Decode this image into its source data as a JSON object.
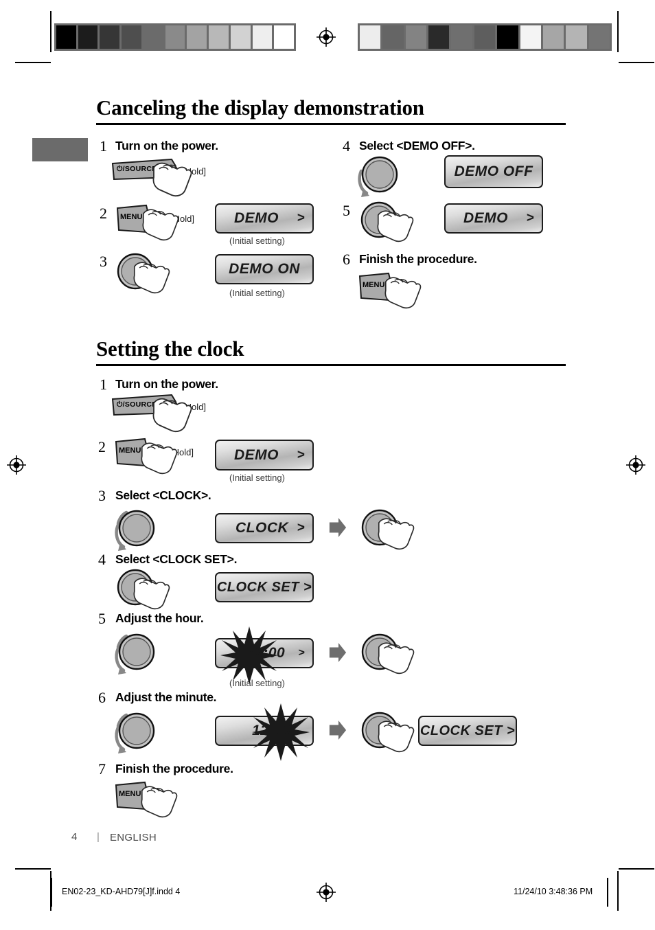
{
  "document": {
    "page_number": "4",
    "page_separator": "|",
    "language": "ENGLISH",
    "print_filename": "EN02-23_KD-AHD79[J]f.indd   4",
    "print_timestamp": "11/24/10   3:48:36 PM"
  },
  "colors": {
    "ink_black": "#000000",
    "side_tab_gray": "#6b6b6b",
    "lcd_border": "#1c1c1c",
    "button_gray": "#a8a8a8",
    "knob_gray": "#b0b0b0",
    "arrow_gray": "#6e6e6e",
    "caption_gray": "#3a3a3a",
    "footer_gray": "#4a4a4a"
  },
  "calibration": {
    "left_bar_swatches": [
      "#000000",
      "#1c1c1c",
      "#363636",
      "#4e4e4e",
      "#6b6b6b",
      "#8a8a8a",
      "#a3a3a3",
      "#b8b8b8",
      "#d2d2d2",
      "#eeeeee",
      "#ffffff"
    ],
    "right_bar_swatches": [
      "#ededed",
      "#656565",
      "#838383",
      "#2a2a2a",
      "#6f6f6f",
      "#5e5e5e",
      "#000000",
      "#f4f4f4",
      "#a6a6a6",
      "#b4b4b4",
      "#747474"
    ]
  },
  "sections": [
    {
      "id": "canceling-display-demonstration",
      "title": "Canceling the display demonstration",
      "steps": [
        {
          "num": "1",
          "text": "Turn on the power.",
          "hold": "[Hold]",
          "control": "source-button"
        },
        {
          "num": "2",
          "hold": "[Hold]",
          "control": "menu-button",
          "lcd": "DEMO",
          "lcd_arrow": ">",
          "caption": "(Initial setting)"
        },
        {
          "num": "3",
          "control": "press-knob",
          "lcd": "DEMO ON",
          "caption": "(Initial setting)"
        },
        {
          "num": "4",
          "text": "Select <DEMO OFF>.",
          "control": "rotate-knob",
          "lcd": "DEMO OFF"
        },
        {
          "num": "5",
          "control": "press-knob",
          "lcd": "DEMO",
          "lcd_arrow": ">"
        },
        {
          "num": "6",
          "text": "Finish the procedure.",
          "control": "menu-button"
        }
      ]
    },
    {
      "id": "setting-the-clock",
      "title": "Setting the clock",
      "steps": [
        {
          "num": "1",
          "text": "Turn on the power.",
          "hold": "[Hold]",
          "control": "source-button"
        },
        {
          "num": "2",
          "hold": "[Hold]",
          "control": "menu-button",
          "lcd": "DEMO",
          "lcd_arrow": ">",
          "caption": "(Initial setting)"
        },
        {
          "num": "3",
          "text": "Select <CLOCK>.",
          "control": "rotate-knob",
          "lcd": "CLOCK",
          "lcd_arrow": ">",
          "then": "press-knob"
        },
        {
          "num": "4",
          "text": "Select <CLOCK SET>.",
          "control": "press-knob",
          "lcd": "CLOCK SET >"
        },
        {
          "num": "5",
          "text": "Adjust the hour.",
          "control": "rotate-knob",
          "lcd": "12:00",
          "lcd_arrow": ">",
          "caption": "(Initial setting)",
          "blink": "hour",
          "then": "press-knob"
        },
        {
          "num": "6",
          "text": "Adjust the minute.",
          "control": "rotate-knob",
          "lcd": "12:00",
          "blink": "minute",
          "then": "press-knob",
          "result_lcd": "CLOCK SET >"
        },
        {
          "num": "7",
          "text": "Finish the procedure.",
          "control": "menu-button"
        }
      ]
    }
  ],
  "controls": {
    "source_label": "⏻/SOURCE",
    "menu_label": "MENU"
  }
}
